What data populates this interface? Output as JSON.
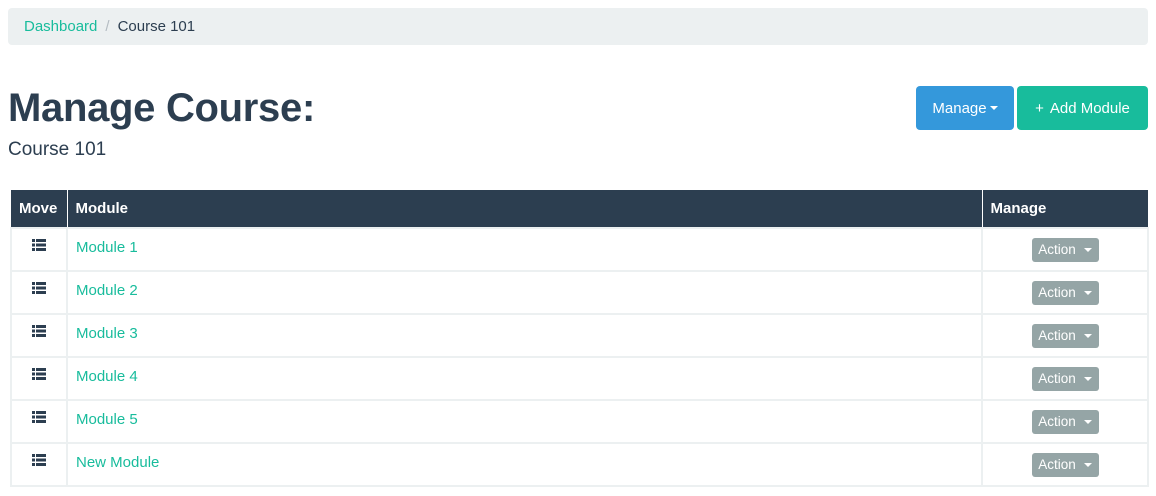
{
  "breadcrumb": {
    "home": "Dashboard",
    "separator": "/",
    "current": "Course 101"
  },
  "header": {
    "title": "Manage Course:",
    "subtitle": "Course 101"
  },
  "toolbar": {
    "manage_label": "Manage",
    "add_icon": "+",
    "add_label": "Add Module"
  },
  "table": {
    "columns": [
      "Move",
      "Module",
      "Manage"
    ],
    "action_label": "Action",
    "rows": [
      {
        "module": "Module 1"
      },
      {
        "module": "Module 2"
      },
      {
        "module": "Module 3"
      },
      {
        "module": "Module 4"
      },
      {
        "module": "Module 5"
      },
      {
        "module": "New Module"
      }
    ]
  },
  "colors": {
    "primary": "#2c3e50",
    "success": "#18bc9c",
    "info": "#3498db",
    "muted": "#95a5a6",
    "light": "#ecf0f1"
  },
  "icons": {
    "move": "list-icon",
    "dropdown": "caret-down-icon"
  }
}
